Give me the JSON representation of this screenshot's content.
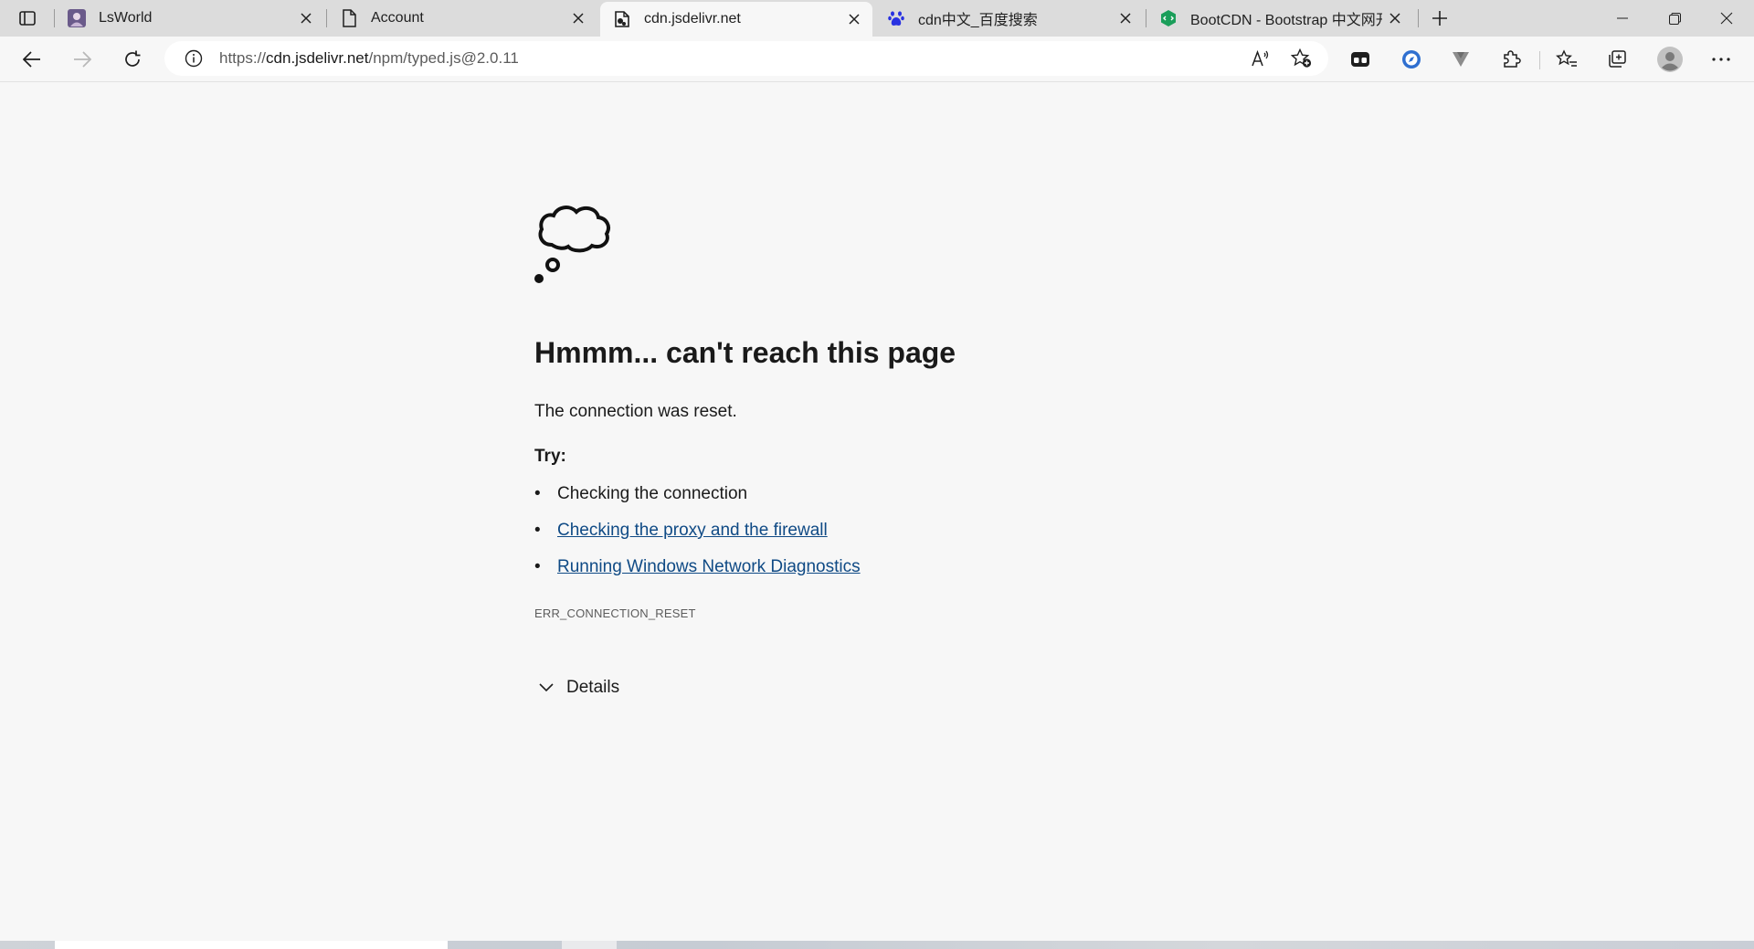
{
  "tabs": [
    {
      "title": "LsWorld",
      "favicon": "avatar-favicon"
    },
    {
      "title": "Account",
      "favicon": "page-icon"
    },
    {
      "title": "cdn.jsdelivr.net",
      "favicon": "broken-page-icon",
      "active": true
    },
    {
      "title": "cdn中文_百度搜索",
      "favicon": "baidu-paw-icon"
    },
    {
      "title": "BootCDN - Bootstrap 中文网开源",
      "favicon": "bootcdn-icon"
    }
  ],
  "address": {
    "url_prefix": "https://",
    "url_host": "cdn.jsdelivr.net",
    "url_path": "/npm/typed.js@2.0.11"
  },
  "error": {
    "heading": "Hmmm... can't reach this page",
    "description": "The connection was reset.",
    "try_label": "Try:",
    "suggestions": [
      {
        "text": "Checking the connection",
        "link": false
      },
      {
        "text": "Checking the proxy and the firewall",
        "link": true
      },
      {
        "text": "Running Windows Network Diagnostics",
        "link": true
      }
    ],
    "code": "ERR_CONNECTION_RESET",
    "details_label": "Details"
  },
  "colors": {
    "link": "#0f4a85",
    "page_bg": "#f7f7f7",
    "tabstrip_bg": "#dcdcdc"
  }
}
